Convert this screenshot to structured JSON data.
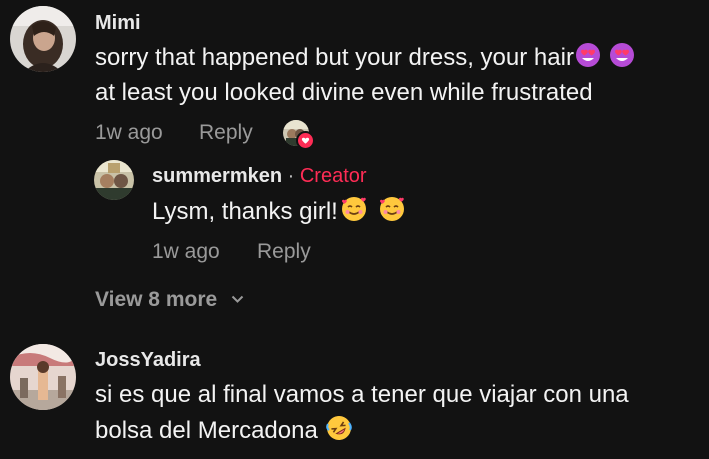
{
  "comments": [
    {
      "username": "Mimi",
      "text_line1": "sorry that happened but your dress, your hair",
      "text_line2": "at least you looked divine even while frustrated",
      "emoji_line1": [
        "heart-eyes-emoji",
        "heart-eyes-emoji"
      ],
      "time": "1w ago",
      "reply_label": "Reply",
      "liked_by_creator": true,
      "replies": [
        {
          "username": "summermken",
          "separator": "·",
          "badge": "Creator",
          "text": "Lysm, thanks girl!",
          "emoji": [
            "smiling-face-with-hearts-emoji",
            "smiling-face-with-hearts-emoji"
          ],
          "time": "1w ago",
          "reply_label": "Reply"
        }
      ],
      "view_more_label": "View 8 more"
    },
    {
      "username": "JossYadira",
      "text_line1": "si es que al final vamos a tener que viajar con una",
      "text_line2": "bolsa del Mercadona",
      "emoji_line2": [
        "rolling-on-floor-laughing-emoji"
      ]
    }
  ],
  "colors": {
    "background": "#121212",
    "text": "#f3f3f3",
    "muted": "#9a9a9a",
    "creator": "#fe2c55"
  }
}
